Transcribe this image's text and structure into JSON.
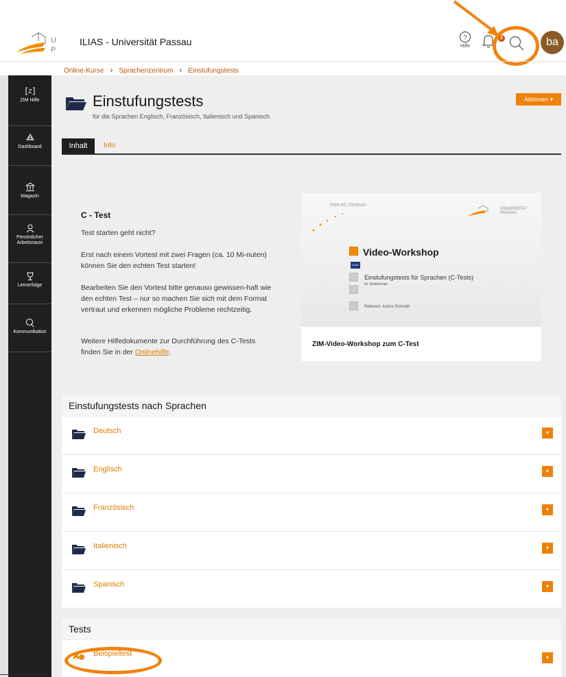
{
  "header": {
    "site_title": "ILIAS - Universität Passau",
    "help_label": "Hilfe",
    "notification_count": "2",
    "avatar_initials": "ba"
  },
  "breadcrumb": [
    "Online-Kurse",
    "Sprachenzentrum",
    "Einstufungstests"
  ],
  "sidebar": [
    {
      "label": "ZIM Hilfe",
      "icon": "zim-help-icon"
    },
    {
      "label": "Dashboard",
      "icon": "dashboard-icon"
    },
    {
      "label": "Magazin",
      "icon": "repository-icon"
    },
    {
      "label": "Persönlicher Arbeitsraum",
      "icon": "personal-workspace-icon"
    },
    {
      "label": "Lernerfolge",
      "icon": "trophy-icon"
    },
    {
      "label": "Kommunikation",
      "icon": "communication-icon"
    }
  ],
  "page": {
    "title": "Einstufungstests",
    "description": "für die Sprachen Englisch, Französisch, Italienisch und Spanisch",
    "actions_label": "Aktionen ▾"
  },
  "tabs": {
    "content": "Inhalt",
    "info": "Info"
  },
  "ctest": {
    "title": "C - Test",
    "p1": "Test starten geht nicht?",
    "p2": "Erst nach einem Vortest mit zwei Fragen (ca. 10 Mi-nuten) können Sie den echten Test starten!",
    "p3": "Bearbeiten Sie den Vortest bitte genauso gewissen-haft wie den echten Test – nur so machen Sie sich mit dem Format vertraut und erkennen mögliche Probleme rechtzeitig.",
    "p4_prefix": "Weitere Hilfedokumente zur Durchführung des C-Tests finden Sie in der ",
    "p4_link": "Onlinehilfe",
    "p4_suffix": "."
  },
  "video": {
    "thumb_top_left": "InteLeC-Zentrum",
    "thumb_top_right": "UNIVERSITÄT PASSAU",
    "thumb_heading": "Video-Workshop",
    "thumb_ilias": "ILIAS",
    "thumb_subtitle": "Einstufungstests für Sprachen (C-Tests)",
    "thumb_subtitle2": "für Studierende",
    "thumb_referent": "Referent: Achim Schmidt",
    "caption": "ZIM-Video-Workshop zum C-Test"
  },
  "languages_block": {
    "heading": "Einstufungstests nach Sprachen",
    "items": [
      "Deutsch",
      "Englisch",
      "Französisch",
      "Italienisch",
      "Spanisch"
    ]
  },
  "tests_block": {
    "heading": "Tests",
    "items": [
      "Beispieltest"
    ]
  },
  "colors": {
    "accent": "#ee8108",
    "link": "#e07b00",
    "sidebar": "#1f1f1f",
    "annotation": "#f0830f"
  }
}
